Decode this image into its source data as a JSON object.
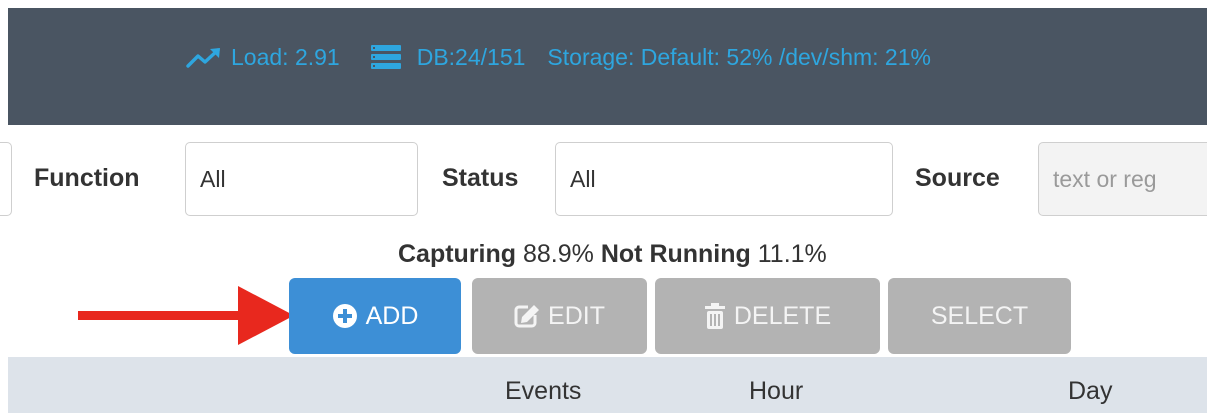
{
  "header": {
    "load_label": "Load: 2.91",
    "db_label": "DB:24/151",
    "storage_label": "Storage: Default: 52% /dev/shm: 21%",
    "accent_color": "#2ea6df",
    "load_icon": "trending-up-icon",
    "db_icon": "server-stack-icon"
  },
  "filters": {
    "function_label": "Function",
    "function_value": "All",
    "status_label": "Status",
    "status_value": "All",
    "source_label": "Source",
    "source_placeholder": "text or reg"
  },
  "summary": {
    "capturing_label": "Capturing",
    "capturing_value": "88.9%",
    "not_running_label": "Not Running",
    "not_running_value": "11.1%"
  },
  "toolbar": {
    "add_label": "ADD",
    "edit_label": "EDIT",
    "delete_label": "DELETE",
    "select_label": "SELECT",
    "add_icon": "plus-circle-icon",
    "edit_icon": "edit-icon",
    "delete_icon": "trash-icon",
    "add_color": "#3d8fd6",
    "disabled_color": "#b3b3b3"
  },
  "annotation": {
    "arrow_color": "#e8281e",
    "arrow_target": "add-button"
  },
  "table": {
    "columns": [
      "Events",
      "Hour",
      "Day"
    ]
  }
}
